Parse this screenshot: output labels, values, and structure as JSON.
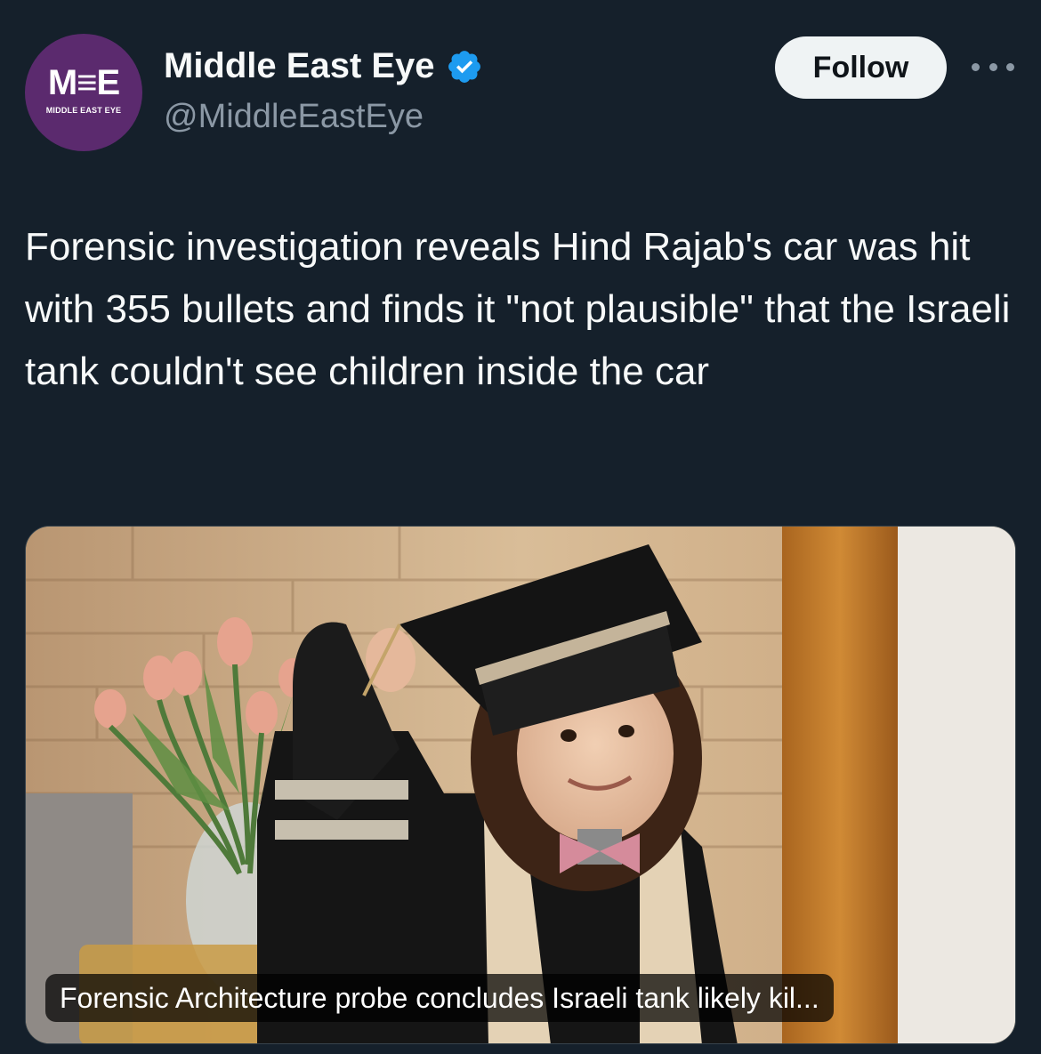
{
  "author": {
    "display_name": "Middle East Eye",
    "handle": "@MiddleEastEye",
    "verified": true,
    "avatar": {
      "mark": "M≡E",
      "subtitle": "MIDDLE EAST EYE",
      "color": "#5b2a6e"
    }
  },
  "actions": {
    "follow_label": "Follow",
    "more_icon": "more-horizontal-icon"
  },
  "tweet": {
    "text": "Forensic investigation reveals Hind Rajab's car was hit with 355 bullets and finds it \"not plausible\" that the Israeli tank couldn't see children inside the car"
  },
  "media": {
    "link_card_title": "Forensic Architecture probe concludes Israeli tank likely kil..."
  },
  "colors": {
    "background": "#15202b",
    "text_primary": "#f7f9f9",
    "text_secondary": "#8b98a5",
    "verified_blue": "#1d9bf0",
    "follow_bg": "#eff3f4"
  }
}
